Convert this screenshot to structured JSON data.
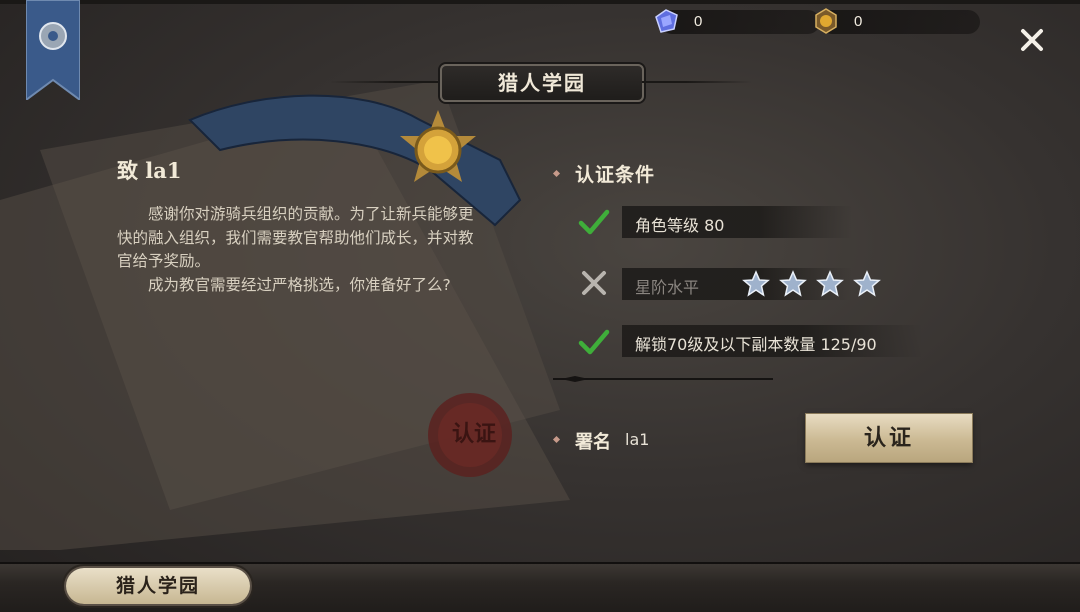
{
  "header": {
    "title": "猎人学园",
    "currencies": [
      {
        "icon": "blue-gem-icon",
        "value": "0"
      },
      {
        "icon": "gold-medal-icon",
        "value": "0"
      }
    ]
  },
  "letter": {
    "greeting": "致 la1",
    "paragraph1": "感谢你对游骑兵组织的贡献。为了让新兵能够更快的融入组织，我们需要教官帮助他们成长，并对教官给予奖励。",
    "paragraph2": "成为教官需要经过严格挑选，你准备好了么?",
    "stamp_text": "认证"
  },
  "conditions": {
    "title": "认证条件",
    "items": [
      {
        "status": "met",
        "label": "角色等级 80"
      },
      {
        "status": "unmet",
        "label": "星阶水平",
        "stars": 4
      },
      {
        "status": "met",
        "label": "解锁70级及以下副本数量 125/90"
      }
    ]
  },
  "signature": {
    "label": "署名",
    "name": "la1"
  },
  "certify_button": "认证",
  "bottom_tab": "猎人学园",
  "colors": {
    "check_green": "#3fae3a",
    "button_gold": "#cbb993",
    "background": "#363230"
  }
}
